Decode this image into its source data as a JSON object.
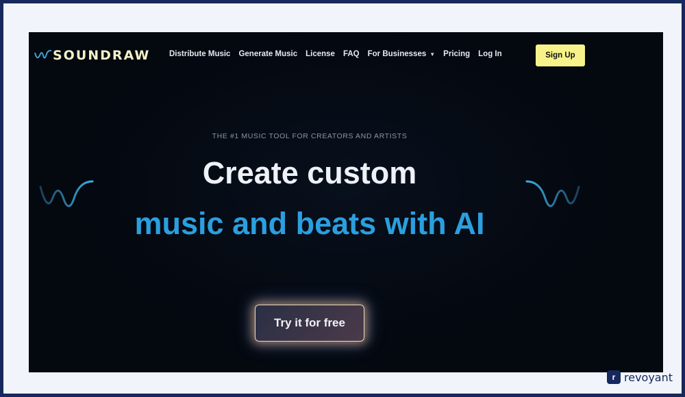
{
  "brand": {
    "logo_text": "SOUNDRAW",
    "icon": "waveform-logo-icon"
  },
  "nav": {
    "items": [
      {
        "label": "Distribute Music"
      },
      {
        "label": "Generate Music"
      },
      {
        "label": "License"
      },
      {
        "label": "FAQ"
      },
      {
        "label": "For Businesses",
        "has_dropdown": true
      },
      {
        "label": "Pricing"
      },
      {
        "label": "Log In"
      }
    ],
    "signup_label": "Sign Up"
  },
  "hero": {
    "eyebrow": "THE #1 MUSIC TOOL FOR CREATORS AND ARTISTS",
    "headline_line1": "Create custom",
    "headline_line2": "music and beats with AI",
    "cta_label": "Try it for free"
  },
  "watermark": {
    "icon_letter": "r",
    "text": "revoyant"
  },
  "colors": {
    "background": "#04080f",
    "accent_blue": "#2b9fdf",
    "signup_yellow": "#f8f28a",
    "frame_navy": "#16285e"
  }
}
